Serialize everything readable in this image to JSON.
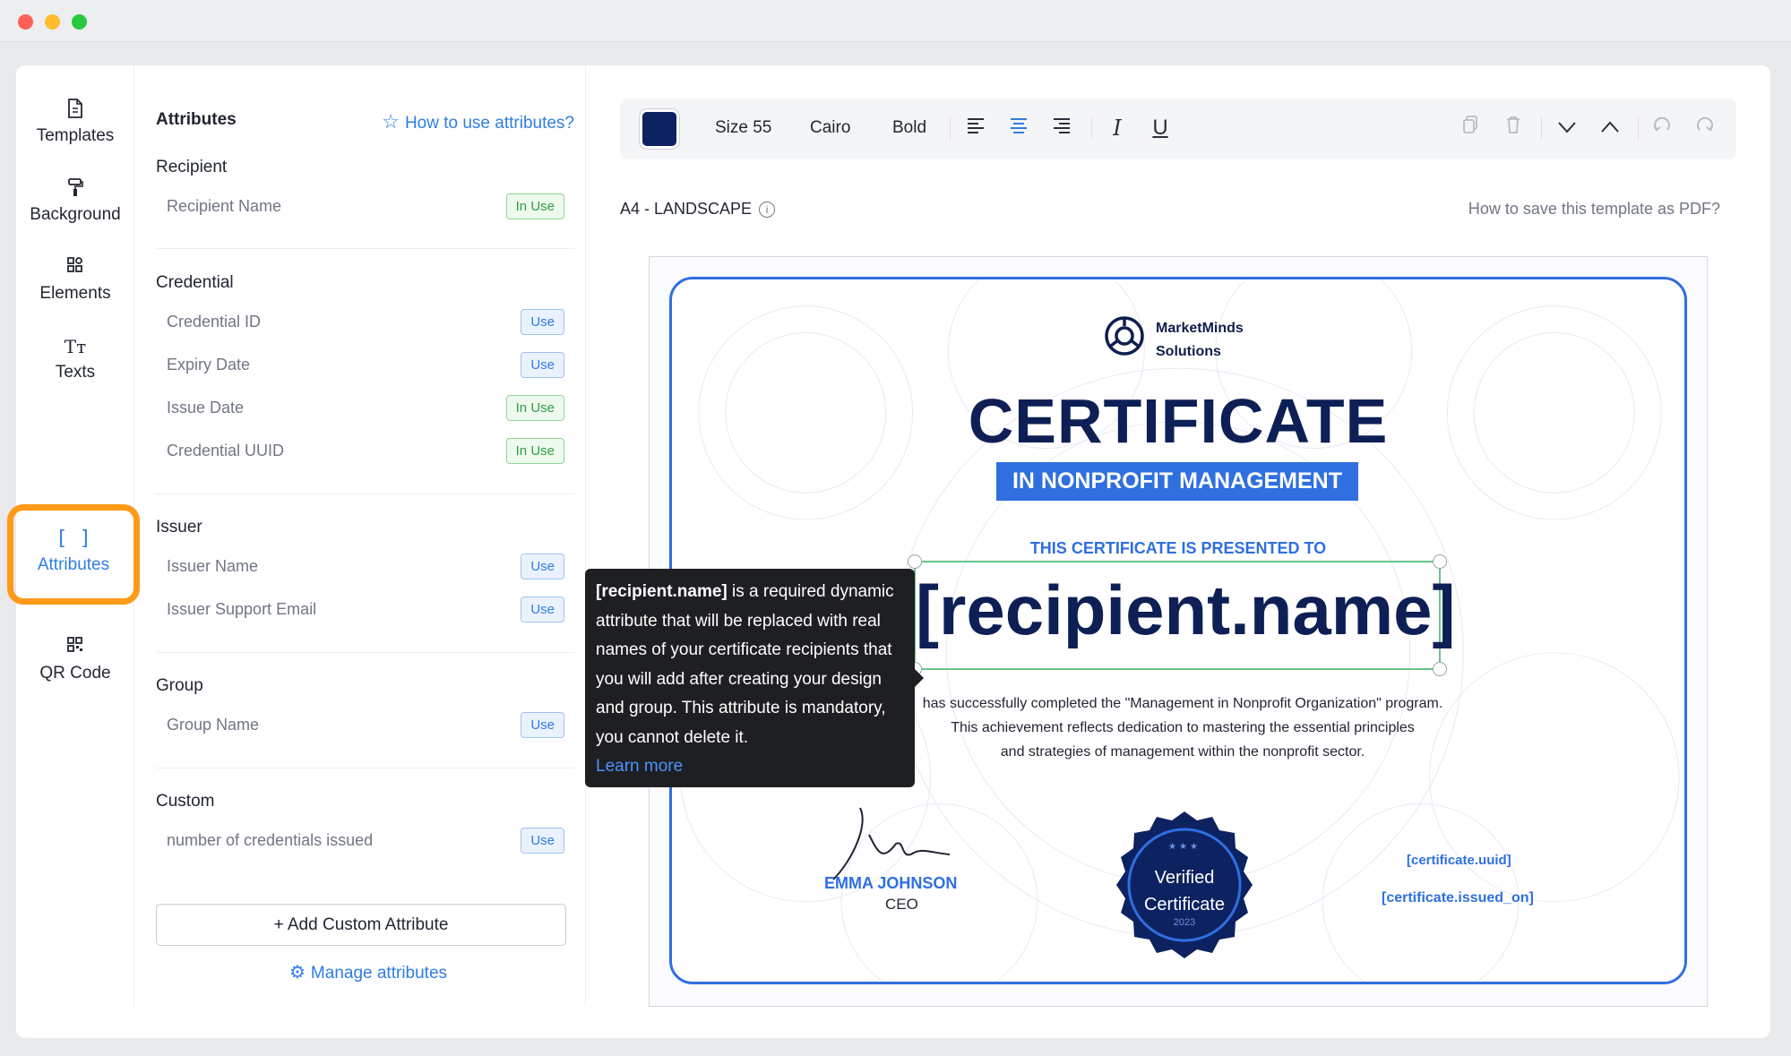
{
  "sidebar": {
    "items": [
      {
        "label": "Templates",
        "icon": "document-icon"
      },
      {
        "label": "Background",
        "icon": "paint-roller-icon"
      },
      {
        "label": "Elements",
        "icon": "grid-icon"
      },
      {
        "label": "Texts",
        "icon": "text-icon"
      },
      {
        "label": "Attributes",
        "icon": "brackets-icon",
        "active": true
      },
      {
        "label": "QR Code",
        "icon": "qr-code-icon"
      }
    ],
    "highlight_color": "#ff9a18"
  },
  "attributes_panel": {
    "title": "Attributes",
    "help_link": "How to use attributes?",
    "sections": [
      {
        "title": "Recipient",
        "rows": [
          {
            "label": "Recipient Name",
            "status": "In Use"
          }
        ]
      },
      {
        "title": "Credential",
        "rows": [
          {
            "label": "Credential ID",
            "status": "Use"
          },
          {
            "label": "Expiry Date",
            "status": "Use"
          },
          {
            "label": "Issue Date",
            "status": "In Use"
          },
          {
            "label": "Credential UUID",
            "status": "In Use"
          }
        ]
      },
      {
        "title": "Issuer",
        "rows": [
          {
            "label": "Issuer Name",
            "status": "Use"
          },
          {
            "label": "Issuer Support Email",
            "status": "Use"
          }
        ]
      },
      {
        "title": "Group",
        "rows": [
          {
            "label": "Group Name",
            "status": "Use"
          }
        ]
      },
      {
        "title": "Custom",
        "rows": [
          {
            "label": "number of credentials issued",
            "status": "Use"
          }
        ]
      }
    ],
    "add_button": "+ Add Custom Attribute",
    "manage_link": "Manage attributes"
  },
  "toolbar": {
    "color": "#0d2260",
    "size": "Size 55",
    "font": "Cairo",
    "weight": "Bold",
    "alignment": "center"
  },
  "canvas": {
    "paper_label": "A4 - LANDSCAPE",
    "pdf_help": "How to save this template as PDF?"
  },
  "certificate": {
    "org_name_line1": "MarketMinds",
    "org_name_line2": "Solutions",
    "title": "CERTIFICATE",
    "subtitle": "IN NONPROFIT MANAGEMENT",
    "presented_to": "THIS CERTIFICATE IS PRESENTED TO",
    "recipient": "[recipient.name]",
    "body_line1": "has successfully completed the \"Management in Nonprofit Organization\" program.",
    "body_line2": "This achievement reflects dedication to mastering the essential principles",
    "body_line3": "and strategies of management within the nonprofit sector.",
    "signer_name": "EMMA JOHNSON",
    "signer_role": "CEO",
    "seal_line1": "Verified",
    "seal_line2": "Certificate",
    "seal_year": "2023",
    "seal_stars": "★★★",
    "uuid_attr": "[certificate.uuid]",
    "issued_attr": "[certificate.issued_on]",
    "border_color": "#2f6fe0",
    "title_color": "#0d1f55"
  },
  "tooltip": {
    "attr": "[recipient.name]",
    "text": " is a required dynamic attribute that will be replaced with real names of your certificate recipients that you will add after creating your design and group. This attribute is mandatory, you cannot delete it.",
    "learn_more": "Learn more"
  }
}
